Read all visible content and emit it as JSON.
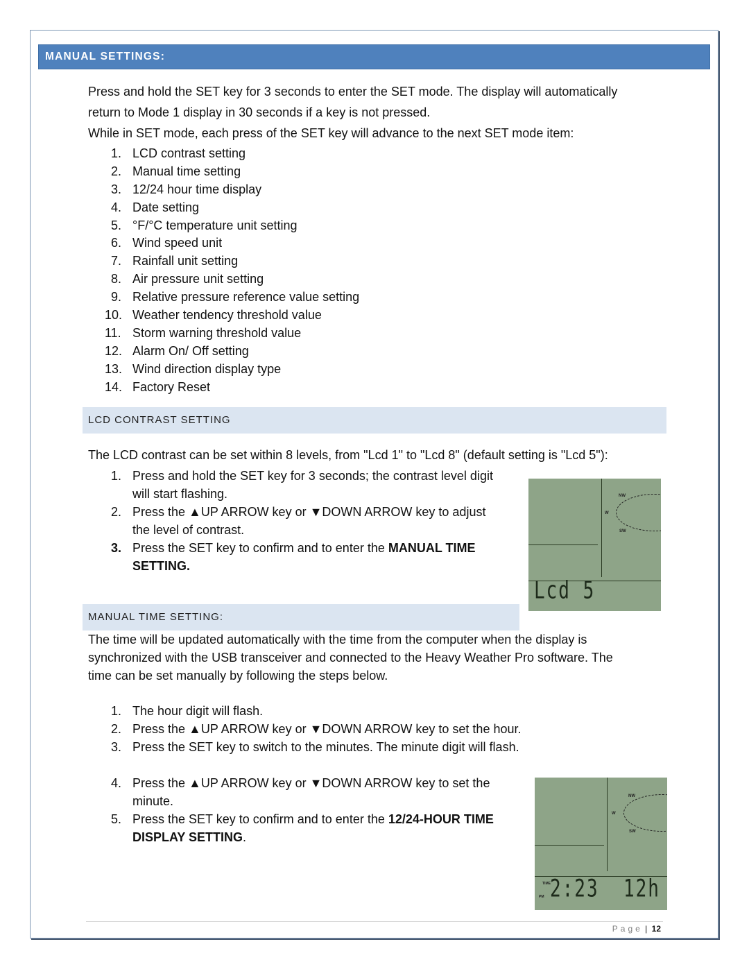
{
  "section_title": "MANUAL SETTINGS:",
  "intro": {
    "line1": "Press and hold the SET key for 3 seconds to enter the SET mode. The display will automatically",
    "line2": "return to Mode 1 display in 30 seconds if a key is not pressed.",
    "line3": "While in SET mode, each press of the SET key will advance to the next SET mode item:"
  },
  "set_mode_items": [
    {
      "num": "1.",
      "text": "LCD contrast setting"
    },
    {
      "num": "2.",
      "text": "Manual time setting"
    },
    {
      "num": "3.",
      "text": "12/24 hour time display"
    },
    {
      "num": "4.",
      "text": "Date setting"
    },
    {
      "num": "5.",
      "text": "°F/°C temperature unit setting"
    },
    {
      "num": "6.",
      "text": "Wind speed unit"
    },
    {
      "num": "7.",
      "text": "Rainfall unit setting"
    },
    {
      "num": "8.",
      "text": "Air pressure unit setting"
    },
    {
      "num": "9.",
      "text": "Relative pressure reference value setting"
    },
    {
      "num": "10.",
      "text": "Weather tendency threshold value"
    },
    {
      "num": "11.",
      "text": "Storm warning threshold value"
    },
    {
      "num": "12.",
      "text": "Alarm On/ Off setting"
    },
    {
      "num": "13.",
      "text": "Wind direction display type"
    },
    {
      "num": "14.",
      "text": "Factory Reset"
    }
  ],
  "lcd_contrast": {
    "heading": "LCD CONTRAST SETTING",
    "intro": "The LCD contrast can be set within 8 levels, from \"Lcd 1\" to \"Lcd 8\" (default setting is \"Lcd 5\"):",
    "steps": [
      {
        "num": "1.",
        "line1": "Press and hold the SET key for 3 seconds; the contrast level digit",
        "line2": "will start flashing."
      },
      {
        "num": "2.",
        "pre": "Press the ",
        "up_arrow": "▲",
        "mid1": "UP ARROW key or ",
        "down_arrow": "▼",
        "mid2": "DOWN ARROW key to adjust",
        "line2": "the level of contrast."
      },
      {
        "num": "3.",
        "pre": "Press the SET key to confirm and to enter the ",
        "bold1": "MANUAL TIME",
        "bold2": "SETTING."
      }
    ],
    "display": {
      "compass_nw": "NW",
      "compass_w": "W",
      "compass_sw": "SW",
      "readout": "Lcd  5"
    }
  },
  "manual_time": {
    "heading": "MANUAL TIME SETTING:",
    "intro_line1": "The time will be updated automatically with the time from the computer when the display is",
    "intro_line2": "synchronized with the USB transceiver and connected to the Heavy Weather Pro software. The",
    "intro_line3": "time can be set manually by following the steps below.",
    "steps": [
      {
        "num": "1.",
        "text": "The hour digit will flash."
      },
      {
        "num": "2.",
        "pre": "Press the ",
        "up_arrow": "▲",
        "mid1": "UP ARROW key or ",
        "down_arrow": "▼",
        "mid2": "DOWN ARROW key to set the hour."
      },
      {
        "num": "3.",
        "text": "Press the SET key to switch to the minutes. The minute digit will flash."
      },
      {
        "num": "4.",
        "pre": "Press the ",
        "up_arrow": "▲",
        "mid1": "UP ARROW key or ",
        "down_arrow": "▼",
        "mid2": "DOWN ARROW key to set the",
        "line2": "minute."
      },
      {
        "num": "5.",
        "pre": "Press the SET key to confirm and to enter the ",
        "bold1": "12/24-HOUR TIME",
        "bold2": "DISPLAY SETTING",
        "tail": "."
      }
    ],
    "display": {
      "compass_nw": "NW",
      "compass_w": "W",
      "compass_sw": "SW",
      "time_label": "TIME",
      "pm_label": "PM",
      "time": "2:23",
      "mode": "12h"
    }
  },
  "footer": {
    "page_label": "Page",
    "separator": "|",
    "page_number": "12"
  }
}
